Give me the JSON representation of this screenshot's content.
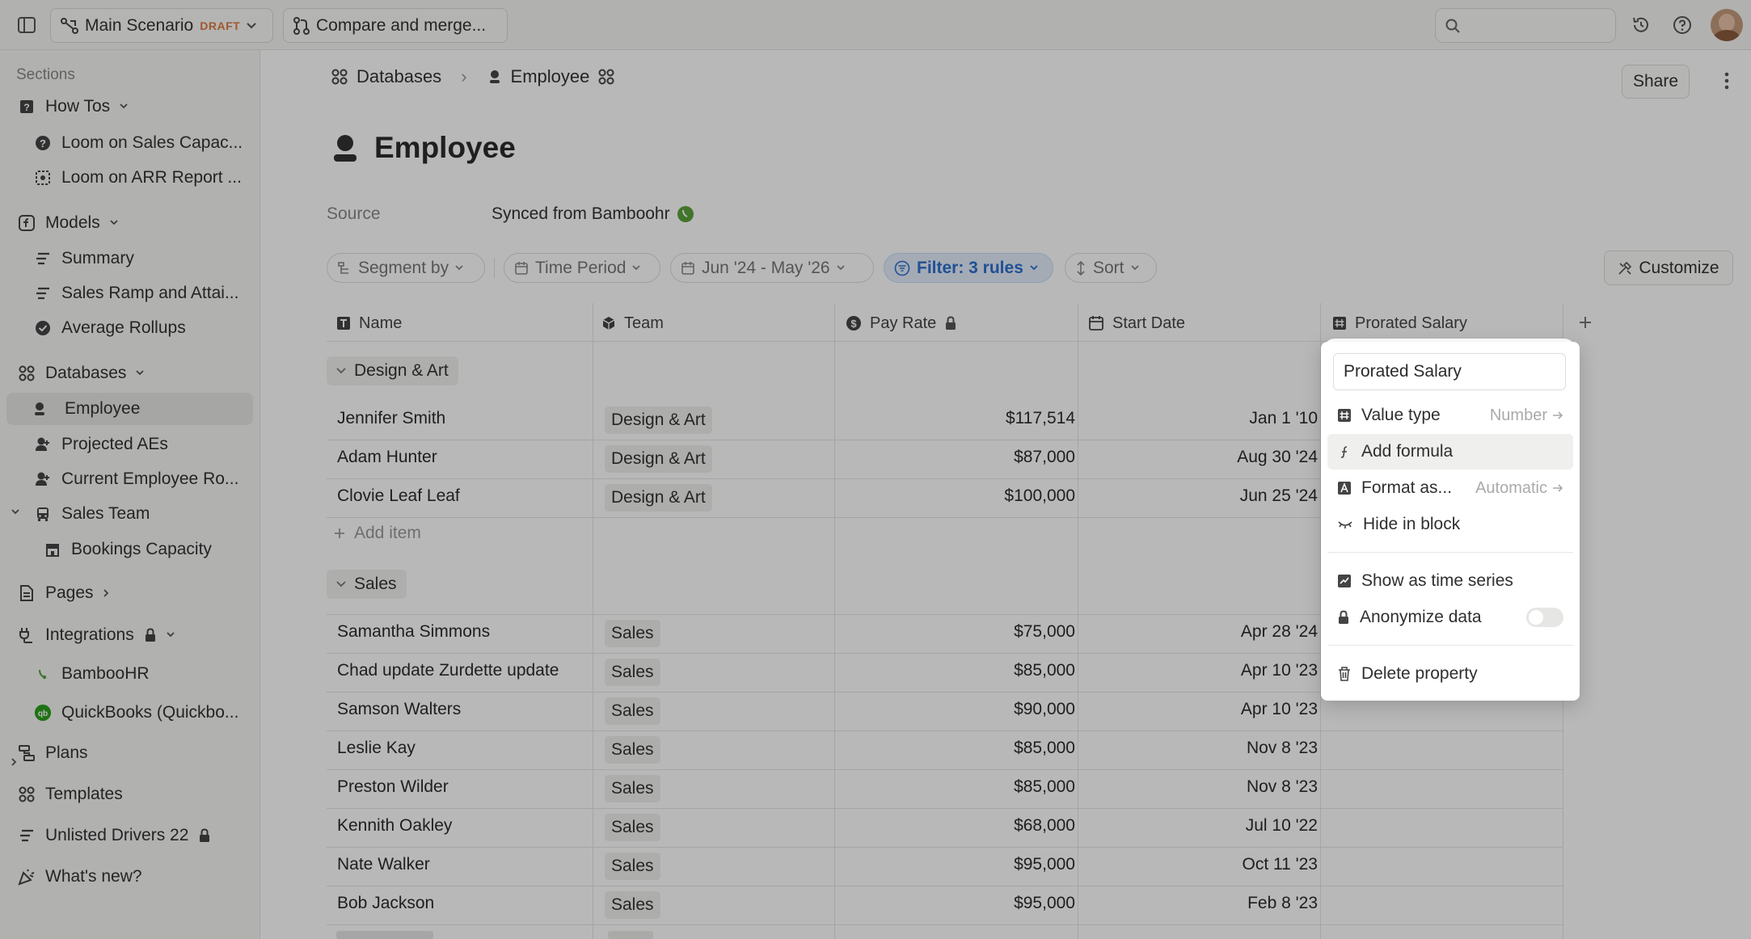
{
  "topbar": {
    "scenario": "Main Scenario",
    "draft_badge": "DRAFT",
    "compare": "Compare and merge...",
    "search_placeholder": ""
  },
  "sidebar": {
    "sections_label": "Sections",
    "howtos": "How Tos",
    "loom1": "Loom on Sales Capac...",
    "loom2": "Loom on ARR Report ...",
    "models": "Models",
    "summary": "Summary",
    "sales_ramp": "Sales Ramp and Attai...",
    "avg_rollups": "Average Rollups",
    "databases": "Databases",
    "employee": "Employee",
    "projected_aes": "Projected AEs",
    "current_emp": "Current Employee Ro...",
    "sales_team": "Sales Team",
    "bookings": "Bookings Capacity",
    "pages": "Pages",
    "integrations": "Integrations",
    "bamboohr": "BambooHR",
    "quickbooks": "QuickBooks (Quickbo...",
    "plans": "Plans",
    "templates": "Templates",
    "unlisted": "Unlisted Drivers 22",
    "whats_new": "What's new?"
  },
  "breadcrumb": {
    "databases": "Databases",
    "employee": "Employee"
  },
  "page": {
    "title": "Employee",
    "source_label": "Source",
    "source_value": "Synced from Bamboohr",
    "share": "Share",
    "customize": "Customize"
  },
  "filters": {
    "segment": "Segment by",
    "time_period": "Time Period",
    "range": "Jun '24 - May '26",
    "filter": "Filter: 3 rules",
    "sort": "Sort"
  },
  "columns": {
    "name": "Name",
    "team": "Team",
    "pay_rate": "Pay Rate",
    "start_date": "Start Date",
    "prorated": "Prorated Salary"
  },
  "groups": [
    {
      "label": "Design & Art",
      "rows": [
        {
          "name": "Jennifer Smith",
          "team": "Design & Art",
          "pay": "$117,514",
          "date": "Jan 1 '10"
        },
        {
          "name": "Adam Hunter",
          "team": "Design & Art",
          "pay": "$87,000",
          "date": "Aug 30 '24"
        },
        {
          "name": "Clovie Leaf Leaf",
          "team": "Design & Art",
          "pay": "$100,000",
          "date": "Jun 25 '24"
        }
      ],
      "add_item": "Add item"
    },
    {
      "label": "Sales",
      "rows": [
        {
          "name": "Samantha Simmons",
          "team": "Sales",
          "pay": "$75,000",
          "date": "Apr 28 '24"
        },
        {
          "name": "Chad update Zurdette update",
          "team": "Sales",
          "pay": "$85,000",
          "date": "Apr 10 '23"
        },
        {
          "name": "Samson Walters",
          "team": "Sales",
          "pay": "$90,000",
          "date": "Apr 10 '23"
        },
        {
          "name": "Leslie Kay",
          "team": "Sales",
          "pay": "$85,000",
          "date": "Nov 8 '23"
        },
        {
          "name": "Preston Wilder",
          "team": "Sales",
          "pay": "$85,000",
          "date": "Nov 8 '23"
        },
        {
          "name": "Kennith Oakley",
          "team": "Sales",
          "pay": "$68,000",
          "date": "Jul 10 '22"
        },
        {
          "name": "Nate Walker",
          "team": "Sales",
          "pay": "$95,000",
          "date": "Oct 11 '23"
        },
        {
          "name": "Bob Jackson",
          "team": "Sales",
          "pay": "$95,000",
          "date": "Feb 8 '23"
        }
      ]
    }
  ],
  "dropdown": {
    "name_value": "Prorated Salary",
    "value_type": "Value type",
    "value_type_val": "Number",
    "add_formula": "Add formula",
    "format_as": "Format as...",
    "format_val": "Automatic",
    "hide": "Hide in block",
    "time_series": "Show as time series",
    "anonymize": "Anonymize data",
    "delete": "Delete property"
  },
  "colors": {
    "accent": "#2f6fcf",
    "bamboo_green": "#5aa33a",
    "quickbooks_green": "#2ca01c"
  }
}
